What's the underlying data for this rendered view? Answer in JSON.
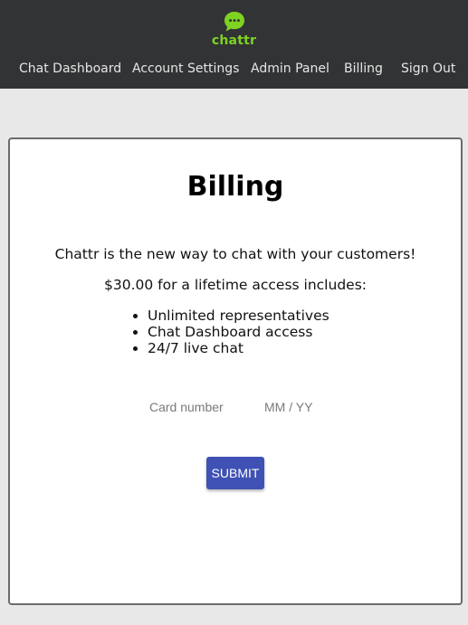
{
  "brand": {
    "name": "chattr",
    "color": "#7ed321",
    "icon": "chat-bubble-icon"
  },
  "nav": {
    "items": [
      {
        "label": "Chat Dashboard"
      },
      {
        "label": "Account Settings"
      },
      {
        "label": "Admin Panel"
      },
      {
        "label": "Billing"
      },
      {
        "label": "Sign Out"
      }
    ]
  },
  "billing": {
    "title": "Billing",
    "tagline": "Chattr is the new way to chat with your customers!",
    "price_text": "$30.00 for a lifetime access includes:",
    "features": [
      "Unlimited representatives",
      "Chat Dashboard access",
      "24/7 live chat"
    ],
    "card_number_placeholder": "Card number",
    "expiry_placeholder": "MM / YY",
    "submit_label": "SUBMIT",
    "accent_color": "#3f51b5"
  }
}
